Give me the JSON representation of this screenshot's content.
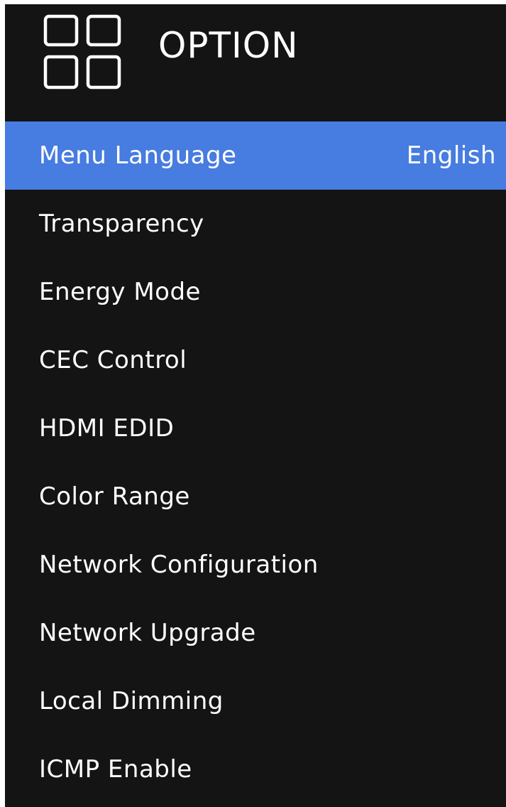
{
  "header": {
    "title": "OPTION",
    "icon": "grid-icon"
  },
  "colors": {
    "background": "#141414",
    "selected": "#477ce0",
    "text": "#ffffff"
  },
  "menu": {
    "items": [
      {
        "label": "Menu Language",
        "value": "English",
        "selected": true
      },
      {
        "label": "Transparency",
        "value": ""
      },
      {
        "label": "Energy Mode",
        "value": ""
      },
      {
        "label": "CEC Control",
        "value": ""
      },
      {
        "label": "HDMI EDID",
        "value": ""
      },
      {
        "label": "Color Range",
        "value": ""
      },
      {
        "label": "Network Configuration",
        "value": ""
      },
      {
        "label": "Network Upgrade",
        "value": ""
      },
      {
        "label": "Local Dimming",
        "value": ""
      },
      {
        "label": "ICMP Enable",
        "value": ""
      }
    ]
  }
}
